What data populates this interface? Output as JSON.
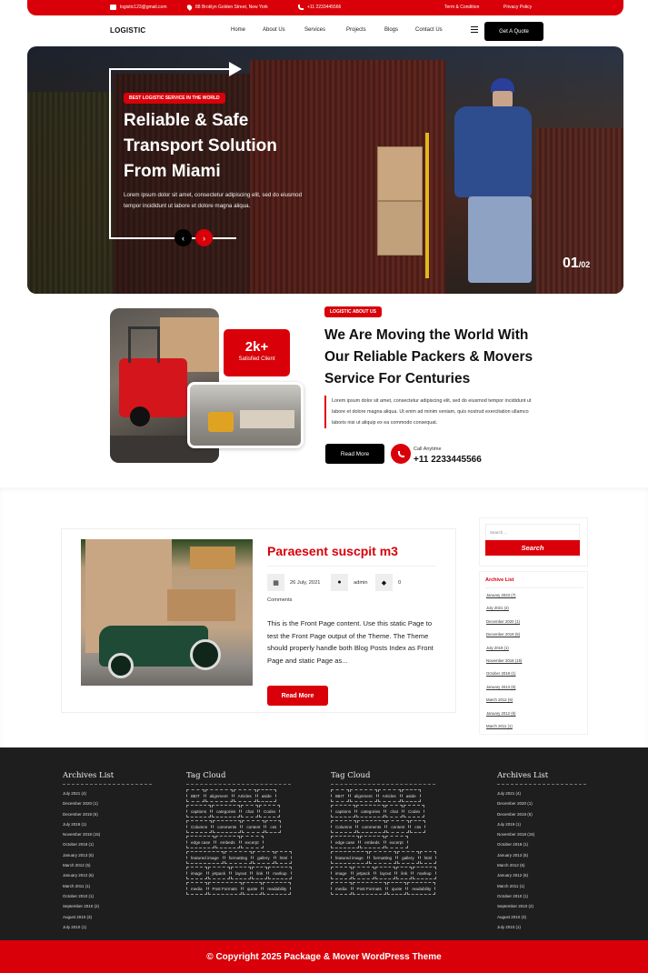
{
  "topbar": {
    "email": "logistic123@gmail.com",
    "address": "88 Broklyn Golden Street, New York",
    "phone": "+11 2233445566",
    "links": [
      "Term & Condition",
      "Privacy Policy"
    ]
  },
  "nav": {
    "logo": "LOGISTIC",
    "items": [
      "Home",
      "About Us",
      "Services",
      "Projects",
      "Blogs",
      "Contact Us"
    ],
    "cta": "Get A Quote"
  },
  "hero": {
    "badge": "BEST LOGISTIC SERVICE IN THE WORLD",
    "title": "Reliable & Safe Transport Solution From Miami",
    "text": "Lorem ipsum dolor sit amet, consectetur adipiscing elit, sed do eiusmod tempor incididunt ut labore et dolore magna aliqua.",
    "prev": "‹",
    "next": "›",
    "slide_current": "01",
    "slide_total": "/02"
  },
  "about": {
    "stat_number": "2k+",
    "stat_label": "Satisfied Client",
    "tag": "LOGISTIC ABOUT US",
    "title": "We Are Moving the World With Our Reliable Packers & Movers Service For Centuries",
    "text": "Lorem ipsum dolor sit amet, consectetur adipiscing elit, sed do eiusmod tempor incididunt ut labore et dolore magna aliqua. Ut enim ad minim veniam, quis nostrud exercitation ullamco laboris nisi ut aliquip ex ea commodo consequat.",
    "button": "Read More",
    "call_label": "Call Anytime",
    "call_number": "+11 2233445566"
  },
  "post": {
    "title": "Paraesent suscpit m3",
    "date": "26 July, 2021",
    "author": "admin",
    "comments_count": "0",
    "comments_label": "Comments",
    "excerpt": "This is the Front Page content. Use this static Page to test the Front Page output of the Theme. The Theme should properly handle both Blog Posts Index as Front Page and static Page as...",
    "button": "Read More"
  },
  "sidebar": {
    "search_placeholder": "Search ...",
    "search_button": "Search",
    "archive_title": "Archive List",
    "archives": [
      "January 2023 (7)",
      "July 2021 (4)",
      "December 2020 (1)",
      "December 2019 (5)",
      "July 2019 (1)",
      "November 2018 (15)",
      "October 2018 (1)",
      "January 2013 (6)",
      "March 2012 (5)",
      "January 2012 (6)",
      "March 2011 (1)"
    ]
  },
  "footer": {
    "archives_title": "Archives List",
    "archives": [
      "July 2021 (4)",
      "December 2020 (1)",
      "December 2019 (5)",
      "July 2019 (1)",
      "November 2018 (15)",
      "October 2018 (1)",
      "January 2013 (5)",
      "March 2012 (5)",
      "January 2012 (6)",
      "March 2011 (1)",
      "October 2010 (1)",
      "September 2010 (2)",
      "August 2010 (3)",
      "July 2010 (1)"
    ],
    "tags_title": "Tag Cloud",
    "tags": [
      "8BIT",
      "alignment",
      "Articles",
      "aside",
      "captions",
      "categories",
      "chat",
      "Codex",
      "Columns",
      "comments",
      "content",
      "css",
      "edge case",
      "embeds",
      "excerpt",
      "featured image",
      "formatting",
      "gallery",
      "html",
      "image",
      "jetpack",
      "layout",
      "link",
      "markup",
      "media",
      "Post Formats",
      "quote",
      "readability"
    ],
    "copyright": "© Copyright 2025 Package & Mover WordPress Theme"
  },
  "colors": {
    "accent": "#d90009",
    "footer_bg": "#1e1e1e",
    "dark_button": "#000000"
  }
}
